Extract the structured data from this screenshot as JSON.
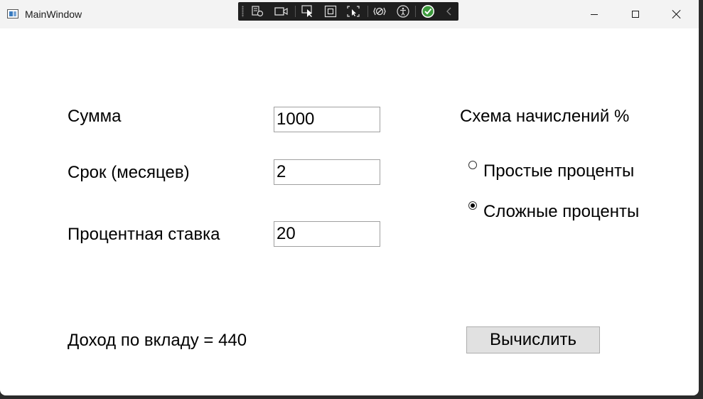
{
  "window": {
    "title": "MainWindow"
  },
  "form": {
    "amount_label": "Сумма",
    "amount_value": "1000",
    "term_label": "Срок (месяцев)",
    "term_value": "2",
    "rate_label": "Процентная ставка",
    "rate_value": "20",
    "scheme_label": "Схема начислений %",
    "options": [
      {
        "label": "Простые проценты",
        "checked": false
      },
      {
        "label": "Сложные проценты",
        "checked": true
      }
    ],
    "result_text": "Доход по вкладу = 440",
    "calc_button": "Вычислить"
  },
  "debug_toolbar": {
    "icons": [
      "live-visual-tree-icon",
      "video-icon",
      "select-element-icon",
      "display-layout-adorners-icon",
      "track-focus-icon",
      "binding-failures-icon",
      "accessibility-icon",
      "checkmark-icon",
      "collapse-chevron-icon"
    ]
  }
}
